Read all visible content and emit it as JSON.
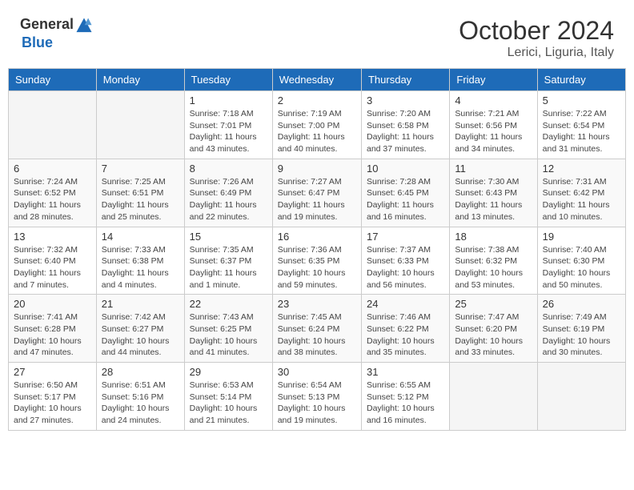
{
  "header": {
    "logo_general": "General",
    "logo_blue": "Blue",
    "month": "October 2024",
    "location": "Lerici, Liguria, Italy"
  },
  "days_of_week": [
    "Sunday",
    "Monday",
    "Tuesday",
    "Wednesday",
    "Thursday",
    "Friday",
    "Saturday"
  ],
  "weeks": [
    [
      {
        "day": "",
        "info": ""
      },
      {
        "day": "",
        "info": ""
      },
      {
        "day": "1",
        "info": "Sunrise: 7:18 AM\nSunset: 7:01 PM\nDaylight: 11 hours and 43 minutes."
      },
      {
        "day": "2",
        "info": "Sunrise: 7:19 AM\nSunset: 7:00 PM\nDaylight: 11 hours and 40 minutes."
      },
      {
        "day": "3",
        "info": "Sunrise: 7:20 AM\nSunset: 6:58 PM\nDaylight: 11 hours and 37 minutes."
      },
      {
        "day": "4",
        "info": "Sunrise: 7:21 AM\nSunset: 6:56 PM\nDaylight: 11 hours and 34 minutes."
      },
      {
        "day": "5",
        "info": "Sunrise: 7:22 AM\nSunset: 6:54 PM\nDaylight: 11 hours and 31 minutes."
      }
    ],
    [
      {
        "day": "6",
        "info": "Sunrise: 7:24 AM\nSunset: 6:52 PM\nDaylight: 11 hours and 28 minutes."
      },
      {
        "day": "7",
        "info": "Sunrise: 7:25 AM\nSunset: 6:51 PM\nDaylight: 11 hours and 25 minutes."
      },
      {
        "day": "8",
        "info": "Sunrise: 7:26 AM\nSunset: 6:49 PM\nDaylight: 11 hours and 22 minutes."
      },
      {
        "day": "9",
        "info": "Sunrise: 7:27 AM\nSunset: 6:47 PM\nDaylight: 11 hours and 19 minutes."
      },
      {
        "day": "10",
        "info": "Sunrise: 7:28 AM\nSunset: 6:45 PM\nDaylight: 11 hours and 16 minutes."
      },
      {
        "day": "11",
        "info": "Sunrise: 7:30 AM\nSunset: 6:43 PM\nDaylight: 11 hours and 13 minutes."
      },
      {
        "day": "12",
        "info": "Sunrise: 7:31 AM\nSunset: 6:42 PM\nDaylight: 11 hours and 10 minutes."
      }
    ],
    [
      {
        "day": "13",
        "info": "Sunrise: 7:32 AM\nSunset: 6:40 PM\nDaylight: 11 hours and 7 minutes."
      },
      {
        "day": "14",
        "info": "Sunrise: 7:33 AM\nSunset: 6:38 PM\nDaylight: 11 hours and 4 minutes."
      },
      {
        "day": "15",
        "info": "Sunrise: 7:35 AM\nSunset: 6:37 PM\nDaylight: 11 hours and 1 minute."
      },
      {
        "day": "16",
        "info": "Sunrise: 7:36 AM\nSunset: 6:35 PM\nDaylight: 10 hours and 59 minutes."
      },
      {
        "day": "17",
        "info": "Sunrise: 7:37 AM\nSunset: 6:33 PM\nDaylight: 10 hours and 56 minutes."
      },
      {
        "day": "18",
        "info": "Sunrise: 7:38 AM\nSunset: 6:32 PM\nDaylight: 10 hours and 53 minutes."
      },
      {
        "day": "19",
        "info": "Sunrise: 7:40 AM\nSunset: 6:30 PM\nDaylight: 10 hours and 50 minutes."
      }
    ],
    [
      {
        "day": "20",
        "info": "Sunrise: 7:41 AM\nSunset: 6:28 PM\nDaylight: 10 hours and 47 minutes."
      },
      {
        "day": "21",
        "info": "Sunrise: 7:42 AM\nSunset: 6:27 PM\nDaylight: 10 hours and 44 minutes."
      },
      {
        "day": "22",
        "info": "Sunrise: 7:43 AM\nSunset: 6:25 PM\nDaylight: 10 hours and 41 minutes."
      },
      {
        "day": "23",
        "info": "Sunrise: 7:45 AM\nSunset: 6:24 PM\nDaylight: 10 hours and 38 minutes."
      },
      {
        "day": "24",
        "info": "Sunrise: 7:46 AM\nSunset: 6:22 PM\nDaylight: 10 hours and 35 minutes."
      },
      {
        "day": "25",
        "info": "Sunrise: 7:47 AM\nSunset: 6:20 PM\nDaylight: 10 hours and 33 minutes."
      },
      {
        "day": "26",
        "info": "Sunrise: 7:49 AM\nSunset: 6:19 PM\nDaylight: 10 hours and 30 minutes."
      }
    ],
    [
      {
        "day": "27",
        "info": "Sunrise: 6:50 AM\nSunset: 5:17 PM\nDaylight: 10 hours and 27 minutes."
      },
      {
        "day": "28",
        "info": "Sunrise: 6:51 AM\nSunset: 5:16 PM\nDaylight: 10 hours and 24 minutes."
      },
      {
        "day": "29",
        "info": "Sunrise: 6:53 AM\nSunset: 5:14 PM\nDaylight: 10 hours and 21 minutes."
      },
      {
        "day": "30",
        "info": "Sunrise: 6:54 AM\nSunset: 5:13 PM\nDaylight: 10 hours and 19 minutes."
      },
      {
        "day": "31",
        "info": "Sunrise: 6:55 AM\nSunset: 5:12 PM\nDaylight: 10 hours and 16 minutes."
      },
      {
        "day": "",
        "info": ""
      },
      {
        "day": "",
        "info": ""
      }
    ]
  ]
}
